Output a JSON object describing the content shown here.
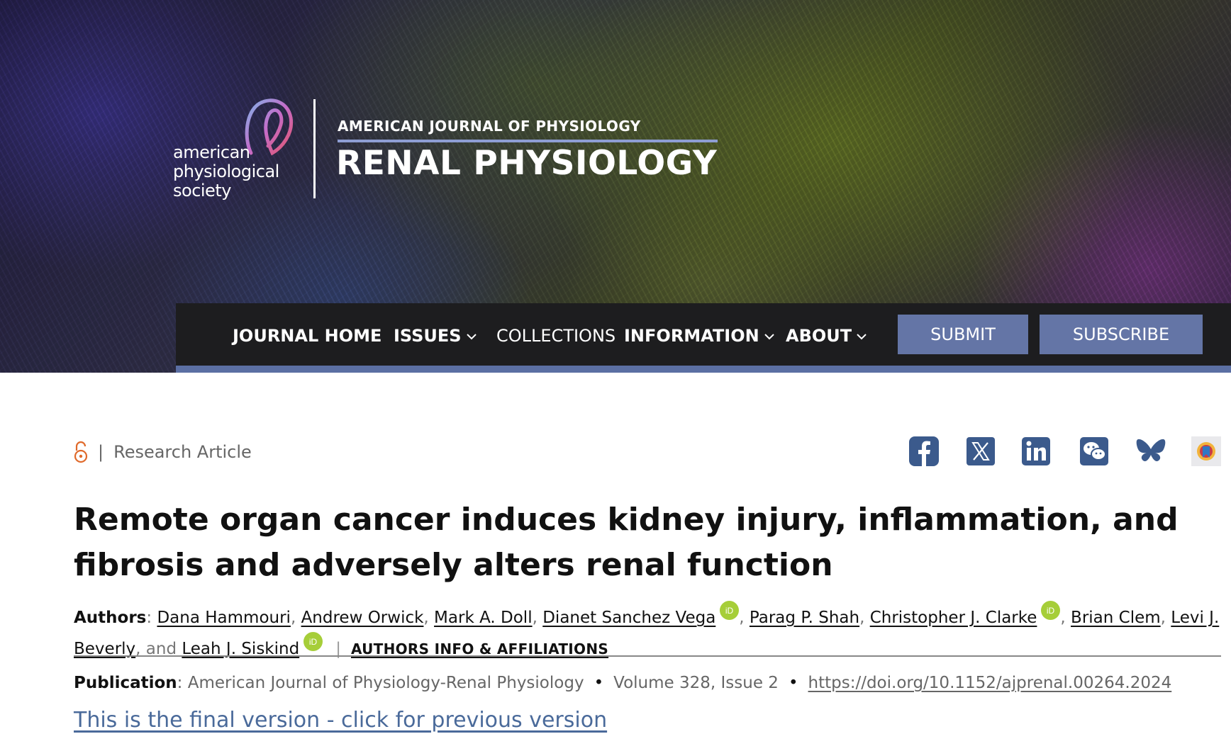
{
  "header": {
    "society_logo_text": "american\nphysiological\nsociety",
    "journal_overline": "AMERICAN JOURNAL OF PHYSIOLOGY",
    "journal_name": "RENAL PHYSIOLOGY"
  },
  "nav": {
    "journal_home": "JOURNAL HOME",
    "issues": "ISSUES",
    "collections": "COLLECTIONS",
    "information": "INFORMATION",
    "about": "ABOUT",
    "submit": "SUBMIT",
    "subscribe": "SUBSCRIBE"
  },
  "article": {
    "access_icon": "open-lock-icon",
    "type": "Research Article",
    "title": "Remote organ cancer induces kidney injury, inflammation, and fibrosis and adversely alters renal function",
    "authors_label": "Authors",
    "authors": [
      {
        "name": "Dana Hammouri",
        "orcid": false
      },
      {
        "name": "Andrew Orwick",
        "orcid": false
      },
      {
        "name": "Mark A. Doll",
        "orcid": false
      },
      {
        "name": "Dianet Sanchez Vega",
        "orcid": true
      },
      {
        "name": "Parag P. Shah",
        "orcid": false
      },
      {
        "name": "Christopher J. Clarke",
        "orcid": true
      },
      {
        "name": "Brian Clem",
        "orcid": false
      },
      {
        "name": "Levi J. Beverly",
        "orcid": false
      },
      {
        "name": "Leah J. Siskind",
        "orcid": true
      }
    ],
    "and_word": "and",
    "affiliations_link": "AUTHORS INFO & AFFILIATIONS",
    "publication_label": "Publication",
    "publication_journal": "American Journal of Physiology-Renal Physiology",
    "volume_issue": "Volume 328, Issue 2",
    "doi": "https://doi.org/10.1152/ajprenal.00264.2024",
    "version_notice": "This is the final version - click for previous version"
  },
  "share": [
    "facebook-icon",
    "x-twitter-icon",
    "linkedin-icon",
    "wechat-icon",
    "bluesky-icon",
    "mendeley-icon"
  ],
  "colors": {
    "nav_bg": "#1d1d1f",
    "nav_button": "#6475a6",
    "social_blue": "#3b5a8c",
    "orcid_green": "#a6ce39",
    "lock_orange": "#e06a2b",
    "version_link": "#4a6a9a"
  }
}
